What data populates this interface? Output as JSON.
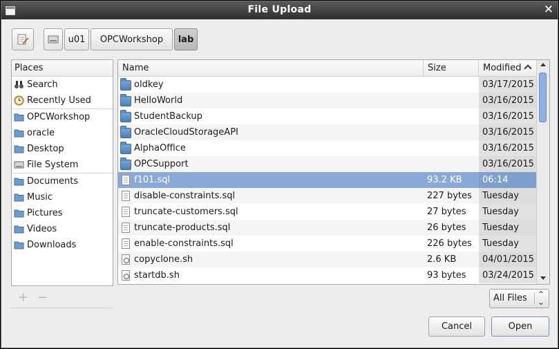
{
  "window": {
    "title": "File Upload"
  },
  "pathbar": {
    "segments": [
      "u01",
      "OPCWorkshop",
      "lab"
    ],
    "active": "lab"
  },
  "places": {
    "header": "Places",
    "groups": [
      [
        {
          "label": "Search",
          "icon": "binoculars-icon"
        },
        {
          "label": "Recently Used",
          "icon": "clock-icon"
        }
      ],
      [
        {
          "label": "OPCWorkshop",
          "icon": "folder-icon"
        },
        {
          "label": "oracle",
          "icon": "home-folder-icon"
        },
        {
          "label": "Desktop",
          "icon": "desktop-folder-icon"
        },
        {
          "label": "File System",
          "icon": "drive-icon"
        }
      ],
      [
        {
          "label": "Documents",
          "icon": "documents-folder-icon"
        },
        {
          "label": "Music",
          "icon": "music-folder-icon"
        },
        {
          "label": "Pictures",
          "icon": "pictures-folder-icon"
        },
        {
          "label": "Videos",
          "icon": "videos-folder-icon"
        },
        {
          "label": "Downloads",
          "icon": "downloads-folder-icon"
        }
      ]
    ],
    "add_label": "+",
    "remove_label": "−"
  },
  "files": {
    "columns": {
      "name": "Name",
      "size": "Size",
      "modified": "Modified"
    },
    "rows": [
      {
        "name": "oldkey",
        "size": "",
        "modified": "03/17/2015",
        "type": "folder"
      },
      {
        "name": "HelloWorld",
        "size": "",
        "modified": "03/16/2015",
        "type": "folder"
      },
      {
        "name": "StudentBackup",
        "size": "",
        "modified": "03/16/2015",
        "type": "folder"
      },
      {
        "name": "OracleCloudStorageAPI",
        "size": "",
        "modified": "03/16/2015",
        "type": "folder"
      },
      {
        "name": "AlphaOffice",
        "size": "",
        "modified": "03/16/2015",
        "type": "folder"
      },
      {
        "name": "OPCSupport",
        "size": "",
        "modified": "03/16/2015",
        "type": "folder"
      },
      {
        "name": "f101.sql",
        "size": "93.2 KB",
        "modified": "06:14",
        "type": "doc",
        "selected": true
      },
      {
        "name": "disable-constraints.sql",
        "size": "227 bytes",
        "modified": "Tuesday",
        "type": "doc"
      },
      {
        "name": "truncate-customers.sql",
        "size": "27 bytes",
        "modified": "Tuesday",
        "type": "doc"
      },
      {
        "name": "truncate-products.sql",
        "size": "26 bytes",
        "modified": "Tuesday",
        "type": "doc"
      },
      {
        "name": "enable-constraints.sql",
        "size": "226 bytes",
        "modified": "Tuesday",
        "type": "doc"
      },
      {
        "name": "copyclone.sh",
        "size": "2.6 KB",
        "modified": "04/01/2015",
        "type": "script"
      },
      {
        "name": "startdb.sh",
        "size": "93 bytes",
        "modified": "03/24/2015",
        "type": "script"
      }
    ]
  },
  "filter": {
    "selected": "All Files"
  },
  "buttons": {
    "cancel": "Cancel",
    "open": "Open"
  },
  "colors": {
    "selection": "#8aa9d6",
    "titlebar": "#3a3a3a"
  }
}
